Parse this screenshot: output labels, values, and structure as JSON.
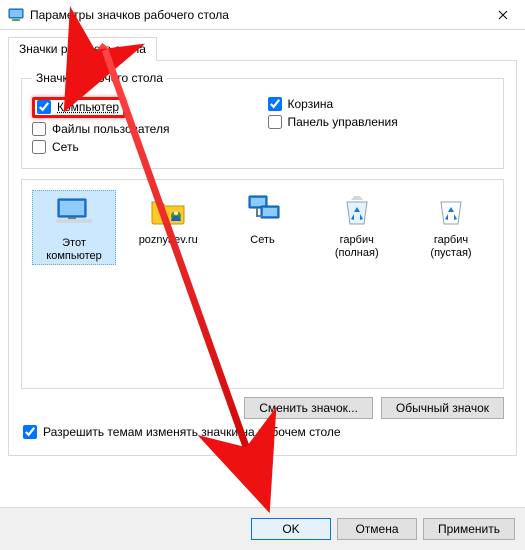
{
  "window": {
    "title": "Параметры значков рабочего стола"
  },
  "tab": {
    "label": "Значки рабочего стола"
  },
  "group": {
    "legend": "Значки рабочего стола",
    "checks": {
      "computer": "Компьютер",
      "recycle": "Корзина",
      "userfiles": "Файлы пользователя",
      "control": "Панель управления",
      "network": "Сеть"
    }
  },
  "icons": {
    "this_pc": "Этот\nкомпьютер",
    "user": "poznyaev.ru",
    "network": "Сеть",
    "bin_full": "гарбич\n(полная)",
    "bin_empty": "гарбич\n(пустая)"
  },
  "buttons": {
    "change_icon": "Сменить значок...",
    "default_icon": "Обычный значок",
    "ok": "OK",
    "cancel": "Отмена",
    "apply": "Применить"
  },
  "themes_check": "Разрешить темам изменять значки на рабочем столе"
}
